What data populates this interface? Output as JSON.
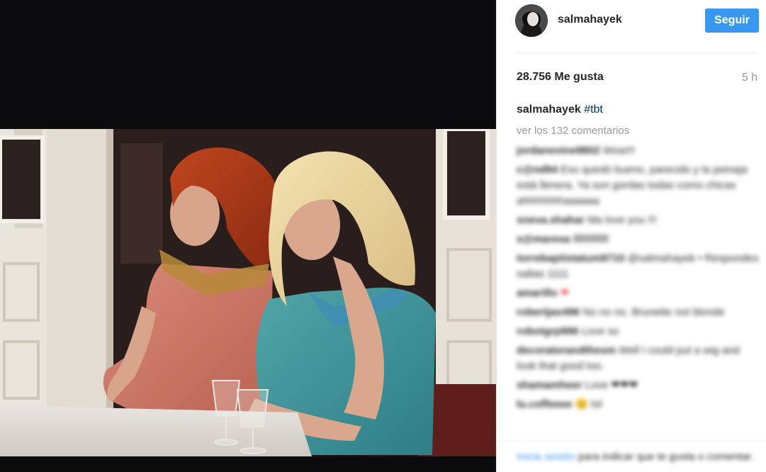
{
  "post": {
    "username": "salmahayek",
    "follow_label": "Seguir",
    "likes": "28.756 Me gusta",
    "time": "5 h",
    "caption_user": "salmahayek",
    "caption_hashtag": "#tbt",
    "view_all": "ver los 132 comentarios"
  },
  "comments": [
    {
      "user": "jordanevine9802",
      "text": "Wow!!!"
    },
    {
      "user": "c@nd94",
      "text": "Eso quedó bueno, parecido y la peinaja está llenera. Ya son gordas todas como chicas ahhhhhhhaaaaaa"
    },
    {
      "user": "sneva.shahar",
      "text": "Ma love you !!!"
    },
    {
      "user": "s@maresa",
      "text": "lllllllllllllll"
    },
    {
      "user": "torrebaptistatum9710",
      "text": "@salmahayek • Respondes saltas 1111"
    },
    {
      "user": "amarillo",
      "text": "❤"
    },
    {
      "user": "robertjax496",
      "text": "No no no. Brunette not blonde"
    },
    {
      "user": "robotgrp996",
      "text": "Love so"
    },
    {
      "user": "decoratorandthesm",
      "text": "Well I could put a wig and look that good too."
    },
    {
      "user": "shamamheer",
      "text": "Love ❤❤❤"
    },
    {
      "user": "lu.coffeeee",
      "text": "😊 lol"
    }
  ],
  "login_prompt": {
    "link": "Inicia sesión",
    "text": "para indicar que te gusta o comentar."
  },
  "colors": {
    "follow_button": "#3897f0",
    "username": "#262626",
    "muted": "#999999",
    "hashtag": "#003569"
  }
}
